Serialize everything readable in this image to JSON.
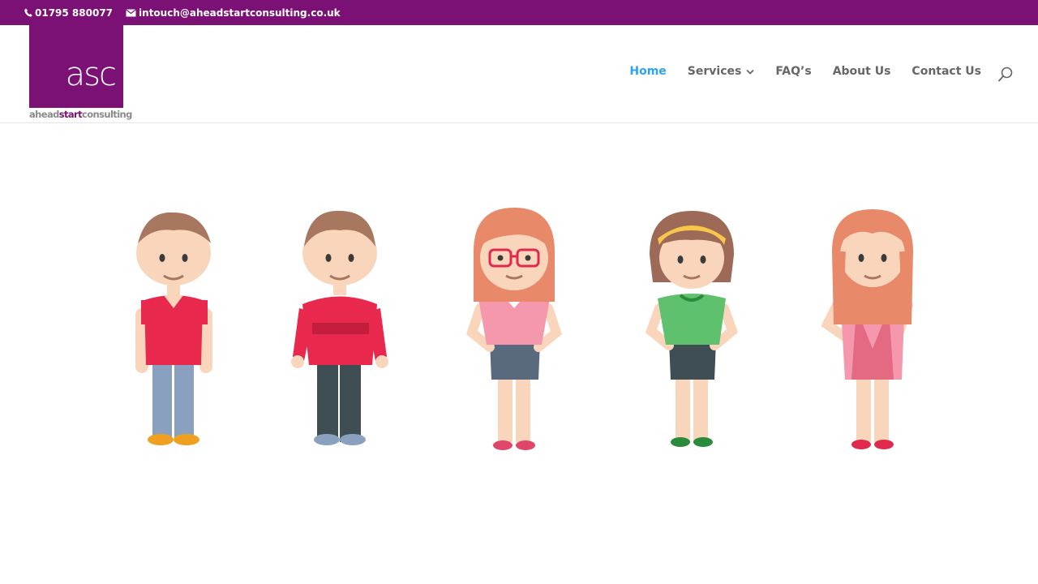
{
  "topbar": {
    "phone": "01795 880077",
    "email": "intouch@aheadstartconsulting.co.uk",
    "background": "#7b1174"
  },
  "logo": {
    "mark": "asc",
    "tagline_part1": "ahead",
    "tagline_part2": "start",
    "tagline_part3": "consulting",
    "brand_color": "#7b1174"
  },
  "nav": {
    "items": [
      {
        "label": "Home",
        "active": true
      },
      {
        "label": "Services",
        "has_dropdown": true
      },
      {
        "label": "FAQ’s"
      },
      {
        "label": "About Us"
      },
      {
        "label": "Contact Us"
      }
    ],
    "active_color": "#2ea3f2"
  },
  "characters": [
    "boy-red-polo",
    "boy-red-sweater",
    "girl-glasses",
    "girl-headband",
    "girl-pink-dress"
  ],
  "icons": {
    "phone": "phone-icon",
    "email": "envelope-icon",
    "dropdown": "chevron-down-icon",
    "search": "search-icon"
  }
}
